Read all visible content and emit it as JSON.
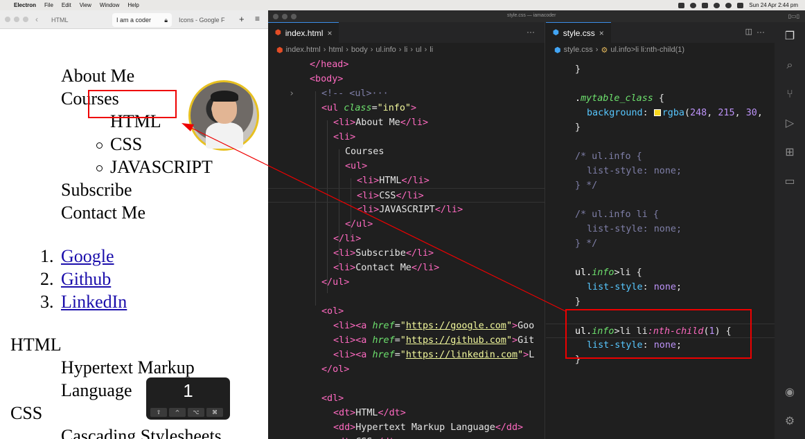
{
  "menubar": {
    "app": "Electron",
    "items": [
      "File",
      "Edit",
      "View",
      "Window",
      "Help"
    ],
    "date_time": "Sun 24 Apr  2:44 pm"
  },
  "browser": {
    "nav_label": "HTML",
    "active_tab": "I am a coder",
    "other_tab": "Icons - Google F",
    "page": {
      "ul_items": [
        "About Me",
        "Courses",
        "Subscribe",
        "Contact Me"
      ],
      "courses_sub": [
        "HTML",
        "CSS",
        "JAVASCRIPT"
      ],
      "ol_numbers": [
        "1.",
        "2.",
        "3."
      ],
      "ol_links": [
        "Google",
        "Github",
        "LinkedIn"
      ],
      "dl": [
        {
          "term": "HTML",
          "def1": "Hypertext Markup",
          "def2": "Language"
        },
        {
          "term": "CSS",
          "def1": "Cascading Stylesheets"
        }
      ]
    },
    "key_overlay": {
      "number": "1",
      "keys": [
        "⇧",
        "^",
        "⌥",
        "⌘"
      ]
    }
  },
  "vscode": {
    "window_title": "style.css — iamacoder",
    "left_tab": "index.html",
    "right_tab": "style.css",
    "left_breadcrumb": [
      "index.html",
      "html",
      "body",
      "ul.info",
      "li",
      "ul",
      "li"
    ],
    "right_breadcrumb": [
      "style.css",
      "ul.info>li li:nth-child(1)"
    ],
    "html_code": [
      "</head>",
      "<body>",
      "<!-- <ul>···",
      "<ul class=\"info\">",
      "<li>About Me</li>",
      "<li>",
      "Courses",
      "<ul>",
      "<li>HTML</li>",
      "<li>CSS</li>",
      "<li>JAVASCRIPT</li>",
      "</ul>",
      "</li>",
      "<li>Subscribe</li>",
      "<li>Contact Me</li>",
      "</ul>",
      "",
      "<ol>",
      "<li><a href=\"https://google.com\">Goo",
      "<li><a href=\"https://github.com\">Git",
      "<li><a href=\"https://linkedin.com\">L",
      "</ol>",
      "",
      "<dl>",
      "<dt>HTML</dt>",
      "<dd>Hypertext Markup Language</dd>",
      "<dt>CSS</dt>"
    ],
    "css_code": [
      "}",
      "",
      ".mytable_class {",
      "background: rgba(248, 215, 30,",
      "}",
      "",
      "/* ul.info {",
      "list-style: none;",
      "} */",
      "",
      "/* ul.info li {",
      "list-style: none;",
      "} */",
      "",
      "ul.info>li {",
      "list-style: none;",
      "}",
      "",
      "ul.info>li li:nth-child(1) {",
      "list-style: none;",
      "}"
    ]
  },
  "colors": {
    "highlight": "#e00000",
    "avatar_ring": "#e7c021",
    "link": "#1a0dab"
  }
}
